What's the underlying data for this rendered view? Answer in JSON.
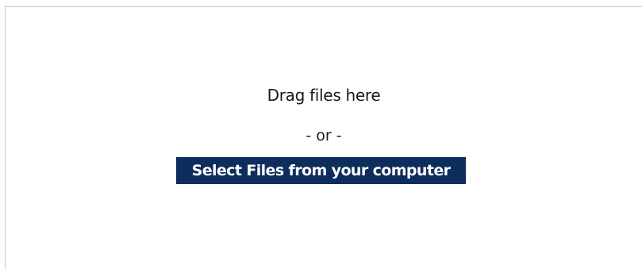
{
  "upload": {
    "drag_label": "Drag files here",
    "separator": "- or -",
    "select_button_label": "Select Files from your computer"
  },
  "colors": {
    "button_bg": "#0d2d5c",
    "button_text": "#ffffff",
    "border": "#c8c8c8"
  }
}
